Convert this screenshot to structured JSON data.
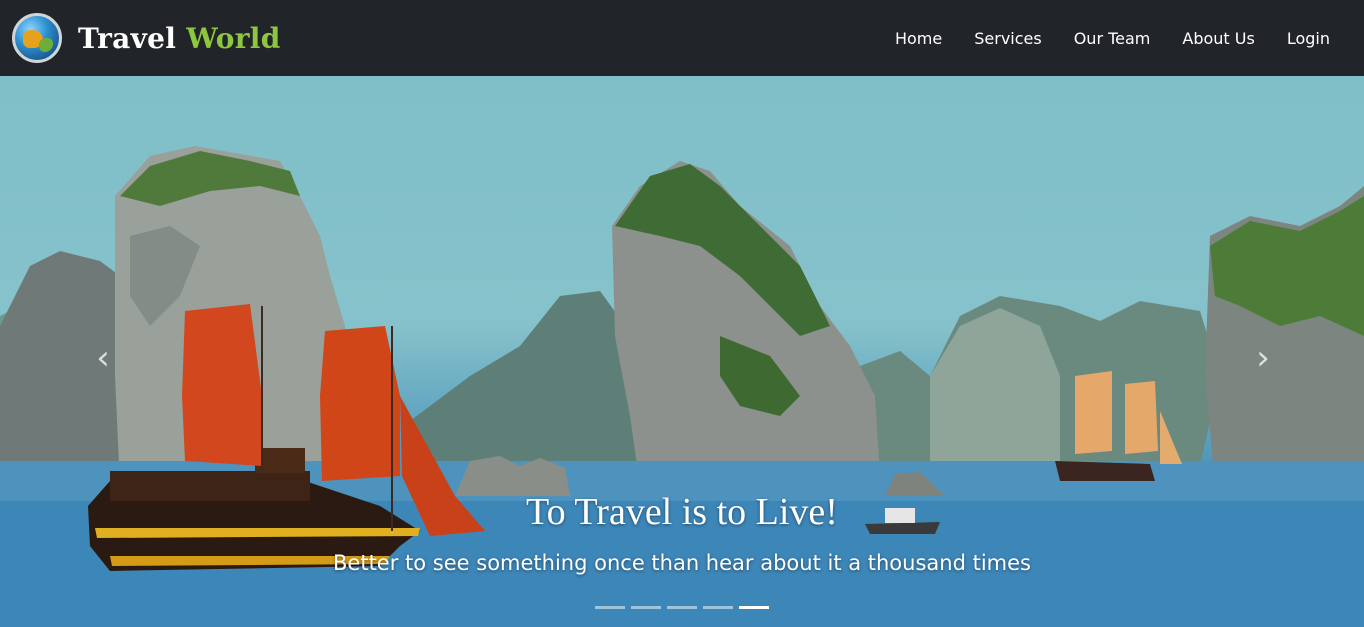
{
  "brand": {
    "word1": "Travel",
    "word2": "World",
    "logo_icon": "globe-icon"
  },
  "nav": [
    {
      "label": "Home"
    },
    {
      "label": "Services"
    },
    {
      "label": "Our Team"
    },
    {
      "label": "About Us"
    },
    {
      "label": "Login"
    }
  ],
  "hero": {
    "title": "To Travel is to Live!",
    "subtitle": "Better to see something once than hear about it a thousand times",
    "prev_icon": "chevron-left-icon",
    "next_icon": "chevron-right-icon",
    "slide_count": 5,
    "active_slide": 5
  },
  "colors": {
    "navbar_bg": "#212428",
    "brand_accent": "#8ec63f",
    "text": "#ffffff"
  }
}
